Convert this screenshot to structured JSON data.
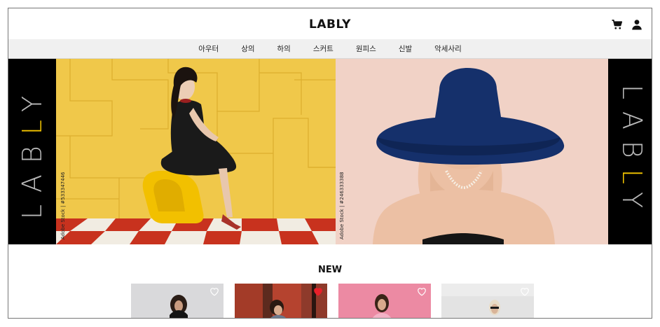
{
  "header": {
    "logo": "LABLY"
  },
  "header_icons": [
    "cart-icon",
    "user-icon"
  ],
  "nav": {
    "items": [
      "아우터",
      "상의",
      "하의",
      "스커트",
      "원피스",
      "신발",
      "악세사리"
    ]
  },
  "banner": {
    "left_brand_word": "LABLY",
    "right_brand_word": "LABLY",
    "credit_left": "Adobe Stock | #533347446",
    "credit_right": "Adobe Stock | #246333388"
  },
  "new_section": {
    "title": "NEW",
    "cards": [
      {
        "liked": false
      },
      {
        "liked": true
      },
      {
        "liked": false
      },
      {
        "liked": false
      }
    ]
  },
  "colors": {
    "brand_highlight": "#f2c400",
    "like_active": "#e8202a",
    "like_inactive": "#ffffff"
  }
}
